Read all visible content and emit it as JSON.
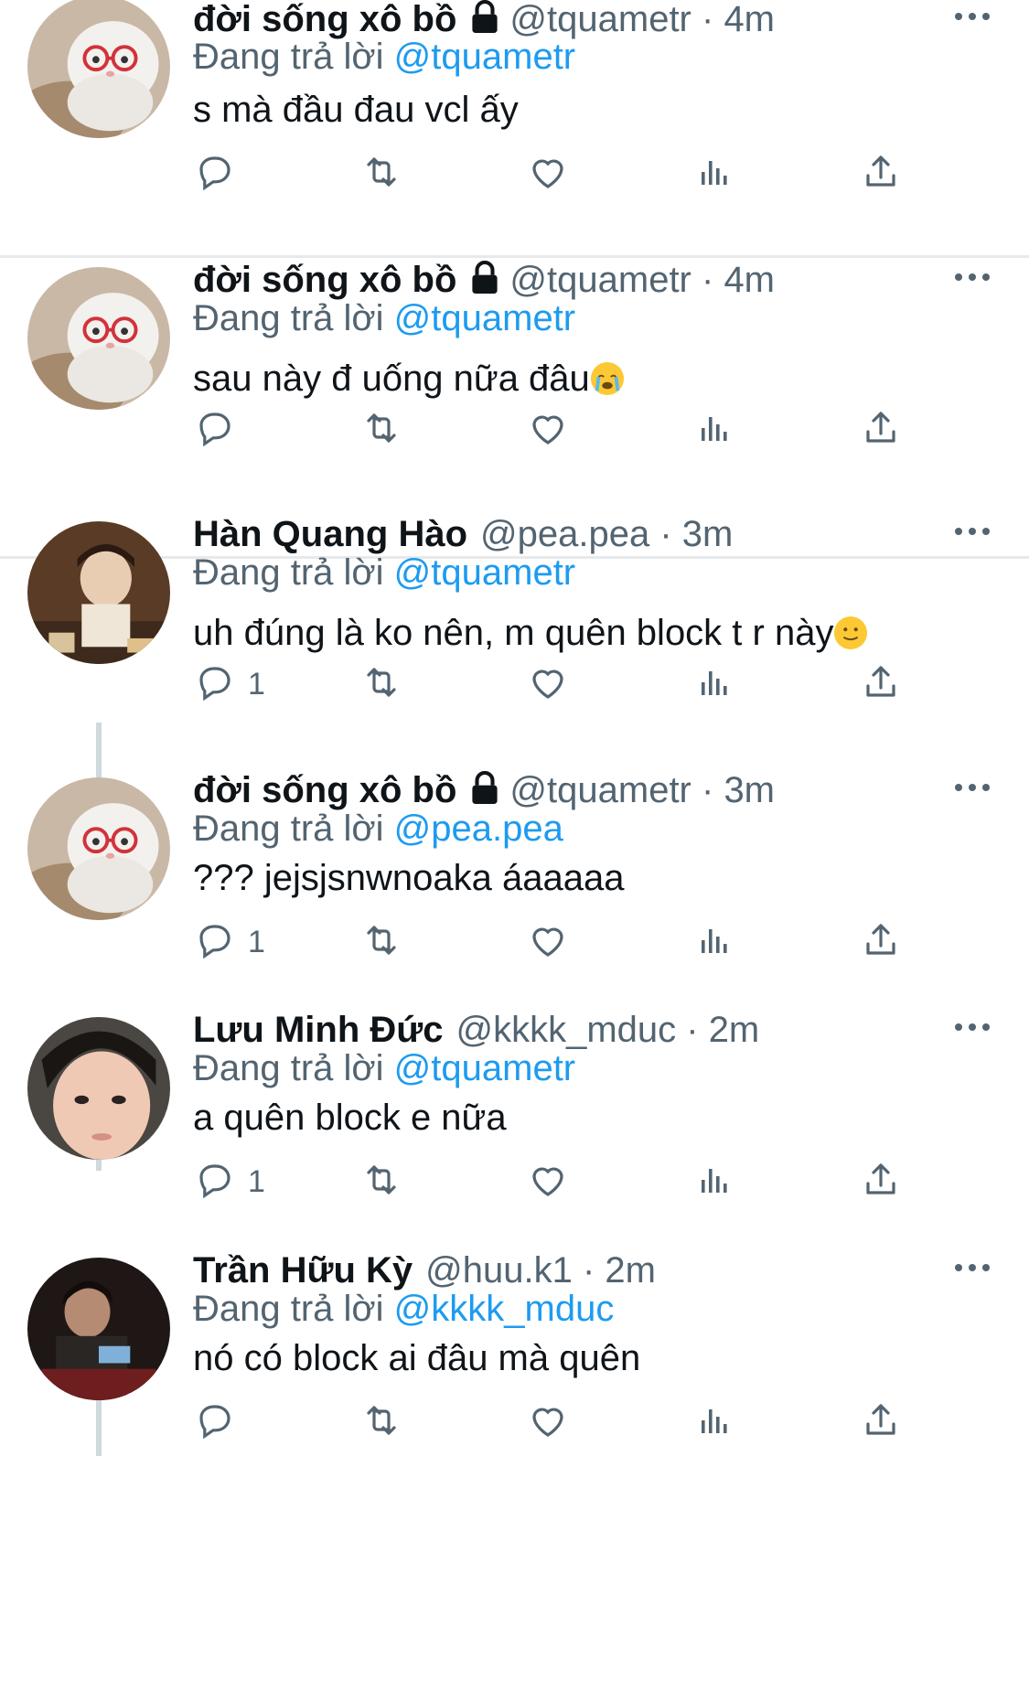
{
  "replying_label": "Đang trả lời",
  "tweets": [
    {
      "name": "đời sống xô bồ",
      "locked": true,
      "handle": "@tquametr",
      "time": "4m",
      "reply_to": "@tquametr",
      "text": "s mà đầu đau vcl ấy",
      "emoji": "",
      "reply_count": "",
      "avatar": "cat"
    },
    {
      "name": "đời sống xô bồ",
      "locked": true,
      "handle": "@tquametr",
      "time": "4m",
      "reply_to": "@tquametr",
      "text": "sau này đ uống nữa đâu",
      "emoji": "crying-face",
      "reply_count": "",
      "avatar": "cat"
    },
    {
      "name": "Hàn Quang Hào",
      "locked": false,
      "handle": "@pea.pea",
      "time": "3m",
      "reply_to": "@tquametr",
      "text": "uh đúng là ko nên, m quên block t r này",
      "emoji": "slight-smile",
      "reply_count": "1",
      "avatar": "person-brown"
    },
    {
      "name": "đời sống xô bồ",
      "locked": true,
      "handle": "@tquametr",
      "time": "3m",
      "reply_to": "@pea.pea",
      "text": "??? jejsjsnwnoaka áaaaaa",
      "emoji": "",
      "reply_count": "1",
      "avatar": "cat"
    },
    {
      "name": "Lưu Minh Đức",
      "locked": false,
      "handle": "@kkkk_mduc",
      "time": "2m",
      "reply_to": "@tquametr",
      "text": "a quên block e nữa",
      "emoji": "",
      "reply_count": "1",
      "avatar": "person-face"
    },
    {
      "name": "Trần Hữu Kỳ",
      "locked": false,
      "handle": "@huu.k1",
      "time": "2m",
      "reply_to": "@kkkk_mduc",
      "text": "nó có block ai đâu mà quên",
      "emoji": "",
      "reply_count": "",
      "avatar": "person-dark"
    }
  ],
  "colors": {
    "link": "#1d9bf0",
    "muted": "#536471",
    "text": "#0f1419",
    "divider": "#e7e9ea",
    "thread": "#cfd9de"
  }
}
